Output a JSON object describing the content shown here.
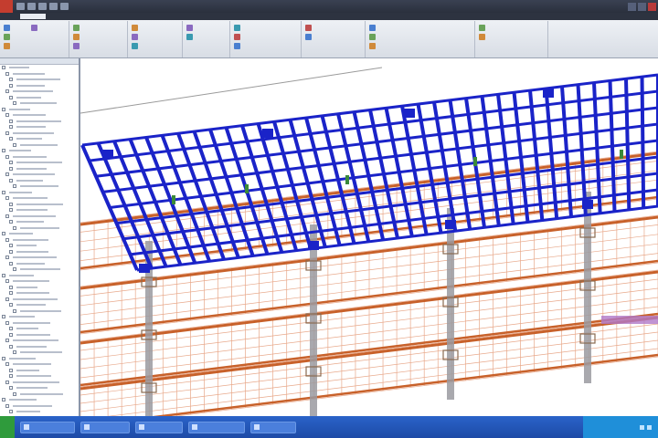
{
  "window": {
    "title": "",
    "controls": [
      "minimize-icon",
      "maximize-icon",
      "close-icon"
    ]
  },
  "quick_access": [
    "open-icon",
    "save-icon",
    "undo-icon",
    "redo-icon",
    "measure-icon"
  ],
  "ribbon": {
    "tabs": [
      "",
      "",
      "",
      "",
      "",
      "",
      "",
      "",
      "",
      ""
    ],
    "active_tab_index": 0,
    "panels": [
      {
        "label": "",
        "buttons": [
          "",
          "",
          "",
          ""
        ]
      },
      {
        "label": "",
        "buttons": [
          "",
          "",
          ""
        ]
      },
      {
        "label": "",
        "buttons": [
          "",
          "",
          ""
        ]
      },
      {
        "label": "",
        "buttons": [
          "",
          ""
        ]
      },
      {
        "label": "",
        "buttons": [
          "",
          "",
          ""
        ]
      },
      {
        "label": "",
        "buttons": [
          "",
          ""
        ]
      },
      {
        "label": "",
        "buttons": [
          "",
          "",
          ""
        ]
      },
      {
        "label": "",
        "buttons": [
          "",
          ""
        ]
      }
    ]
  },
  "project_browser": {
    "title": "",
    "rows": [
      "",
      "",
      "",
      "",
      "",
      "",
      "",
      "",
      "",
      "",
      "",
      "",
      "",
      "",
      "",
      "",
      "",
      "",
      "",
      "",
      "",
      "",
      "",
      "",
      "",
      "",
      "",
      "",
      "",
      "",
      "",
      "",
      "",
      "",
      "",
      "",
      "",
      "",
      "",
      "",
      "",
      "",
      "",
      "",
      "",
      "",
      "",
      "",
      "",
      "",
      "",
      "",
      "",
      "",
      "",
      "",
      "",
      "",
      ""
    ]
  },
  "view": {
    "colors": {
      "selected": "#1a23c8",
      "structure": "#c8612a",
      "column": "#9a9aa0",
      "highlight": "#b078c8",
      "grid": "#e8a88a"
    }
  },
  "taskbar": {
    "tasks": [
      "",
      "",
      "",
      "",
      ""
    ],
    "clock": ""
  }
}
